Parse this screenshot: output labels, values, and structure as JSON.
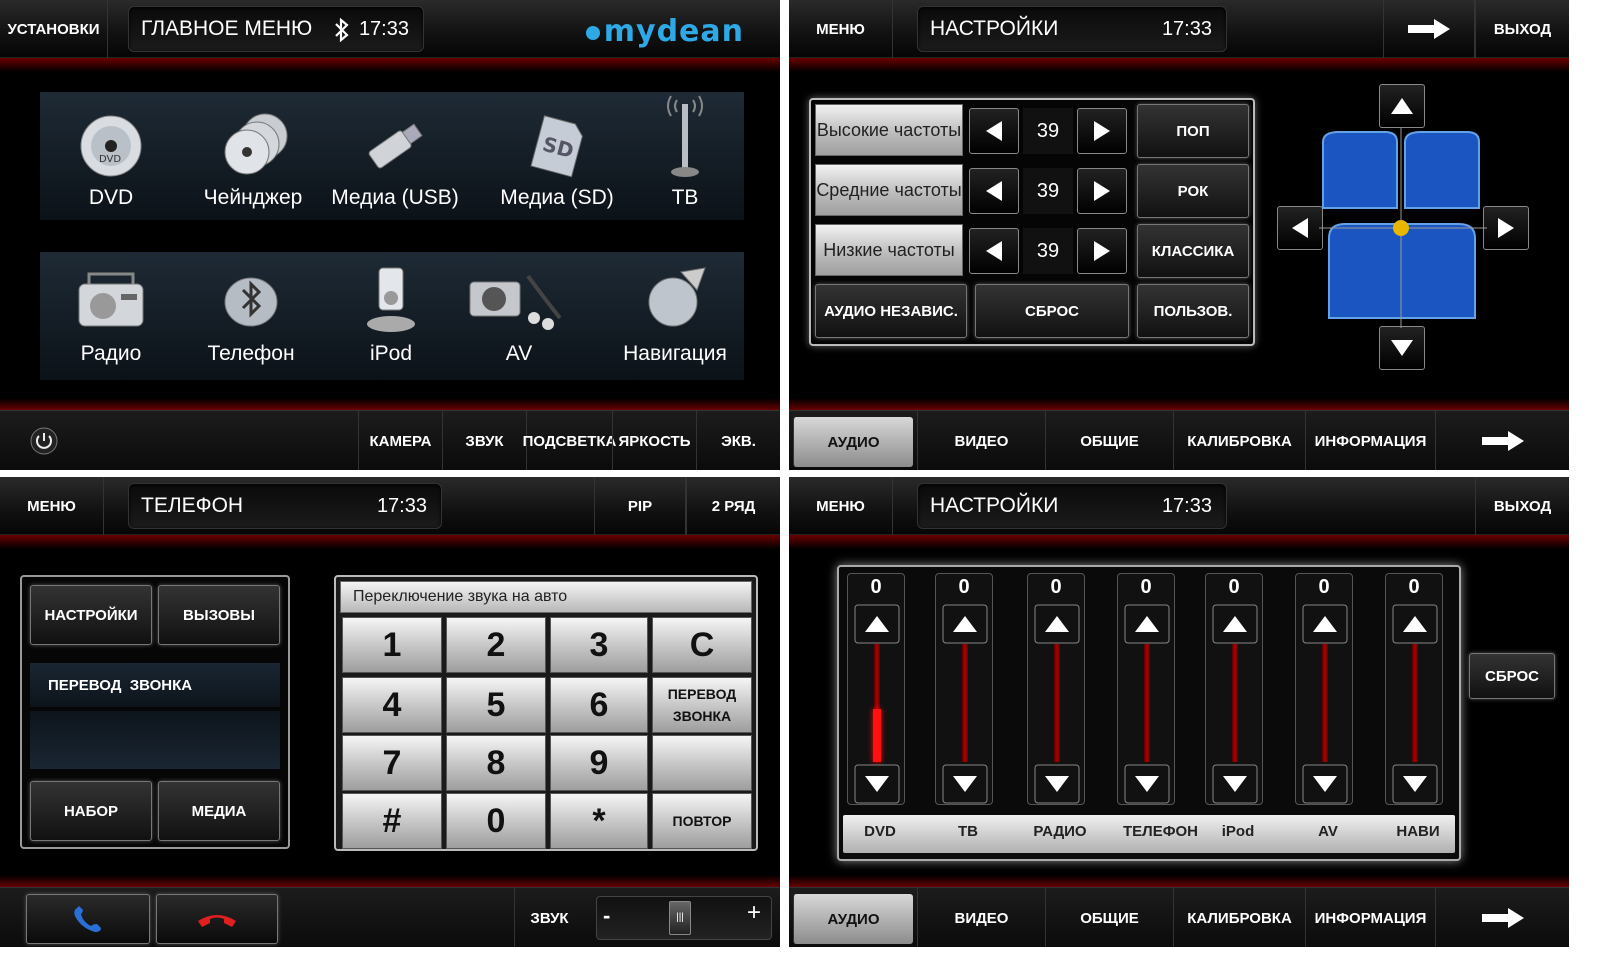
{
  "main_menu": {
    "top": {
      "left_button": "УСТАНОВКИ",
      "title": "ГЛАВНОЕ МЕНЮ",
      "time": "17:33",
      "logo": "mydean"
    },
    "items_row1": [
      {
        "label": "DVD",
        "icon": "dvd-disc-icon"
      },
      {
        "label": "Чейнджер",
        "icon": "changer-discs-icon"
      },
      {
        "label": "Медиа (USB)",
        "icon": "usb-stick-icon"
      },
      {
        "label": "Медиа (SD)",
        "icon": "sd-card-icon"
      },
      {
        "label": "ТВ",
        "icon": "tv-antenna-icon"
      }
    ],
    "items_row2": [
      {
        "label": "Радио",
        "icon": "radio-icon"
      },
      {
        "label": "Телефон",
        "icon": "bluetooth-phone-icon"
      },
      {
        "label": "iPod",
        "icon": "ipod-icon"
      },
      {
        "label": "AV",
        "icon": "av-camera-icon"
      },
      {
        "label": "Навигация",
        "icon": "navigation-globe-icon"
      }
    ],
    "bottom": [
      "КАМЕРА",
      "ЗВУК",
      "ПОДСВЕТКА",
      "ЯРКОСТЬ",
      "ЭКВ."
    ]
  },
  "audio_settings": {
    "top": {
      "left_button": "МЕНЮ",
      "title": "НАСТРОЙКИ",
      "time": "17:33",
      "exit": "ВЫХОД"
    },
    "bands": [
      {
        "label": "Высокие частоты",
        "value": "39"
      },
      {
        "label": "Средние частоты",
        "value": "39"
      },
      {
        "label": "Низкие частоты",
        "value": "39"
      }
    ],
    "presets": [
      "ПОП",
      "РОК",
      "КЛАССИКА"
    ],
    "bottom_row": [
      "АУДИО НЕЗАВИС.",
      "СБРОС",
      "ПОЛЬЗОВ."
    ],
    "tabs": [
      "АУДИО",
      "ВИДЕО",
      "ОБЩИЕ",
      "КАЛИБРОВКА",
      "ИНФОРМАЦИЯ"
    ]
  },
  "phone": {
    "top": {
      "left_button": "МЕНЮ",
      "title": "ТЕЛЕФОН",
      "time": "17:33",
      "pip": "PIP",
      "row2": "2 РЯД"
    },
    "left_buttons": {
      "settings": "НАСТРОЙКИ",
      "calls": "ВЫЗОВЫ",
      "transfer": "ПЕРЕВОД  ЗВОНКА",
      "dial": "НАБОР",
      "media": "МЕДИА"
    },
    "display": "Переключение звука на авто",
    "keys": [
      [
        "1",
        "2",
        "3",
        "C"
      ],
      [
        "4",
        "5",
        "6",
        "ПЕРЕВОД ЗВОНКА"
      ],
      [
        "7",
        "8",
        "9",
        ""
      ],
      [
        "#",
        "0",
        "*",
        "ПОВТОР"
      ]
    ],
    "bottom": {
      "sound": "ЗВУК",
      "minus": "-",
      "plus": "+"
    },
    "colors": {
      "call": "#2a6fd6",
      "hangup": "#e02020"
    }
  },
  "volume_settings": {
    "top": {
      "left_button": "МЕНЮ",
      "title": "НАСТРОЙКИ",
      "time": "17:33",
      "exit": "ВЫХОД"
    },
    "channels": [
      {
        "label": "DVD",
        "value": "0",
        "level": 0.45
      },
      {
        "label": "ТВ",
        "value": "0",
        "level": 0
      },
      {
        "label": "РАДИО",
        "value": "0",
        "level": 0
      },
      {
        "label": "ТЕЛЕФОН",
        "value": "0",
        "level": 0
      },
      {
        "label": "iPod",
        "value": "0",
        "level": 0
      },
      {
        "label": "AV",
        "value": "0",
        "level": 0
      },
      {
        "label": "НАВИ",
        "value": "0",
        "level": 0
      }
    ],
    "reset": "СБРОС",
    "tabs": [
      "АУДИО",
      "ВИДЕО",
      "ОБЩИЕ",
      "КАЛИБРОВКА",
      "ИНФОРМАЦИЯ"
    ]
  }
}
